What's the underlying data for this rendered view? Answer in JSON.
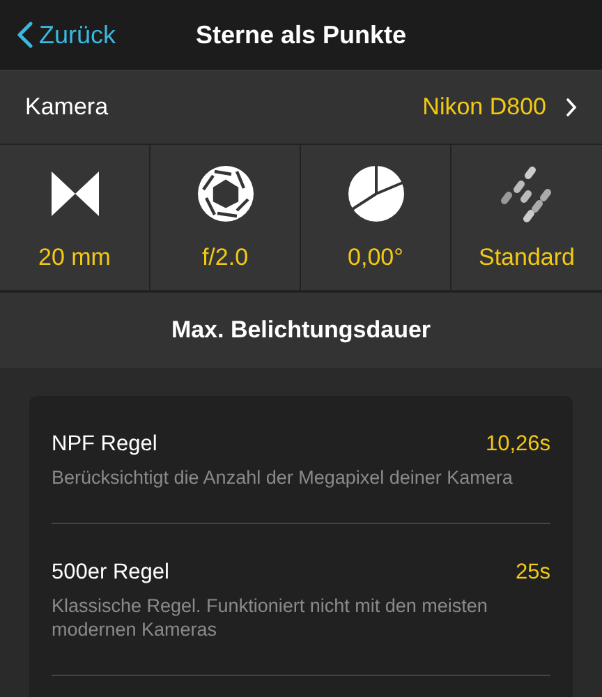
{
  "nav": {
    "back": "Zurück",
    "title": "Sterne als Punkte"
  },
  "camera": {
    "label": "Kamera",
    "value": "Nikon D800"
  },
  "tiles": [
    {
      "kind": "focal",
      "value": "20 mm"
    },
    {
      "kind": "aperture",
      "value": "f/2.0"
    },
    {
      "kind": "angle",
      "value": "0,00°"
    },
    {
      "kind": "stars",
      "value": "Standard"
    }
  ],
  "section": {
    "title": "Max. Belichtungsdauer"
  },
  "rules": [
    {
      "name": "NPF Regel",
      "value": "10,26s",
      "description": "Berücksichtigt die Anzahl der Megapixel deiner Kamera"
    },
    {
      "name": "500er Regel",
      "value": "25s",
      "description": "Klassische Regel. Funktioniert nicht mit den meisten modernen Kameras"
    }
  ]
}
